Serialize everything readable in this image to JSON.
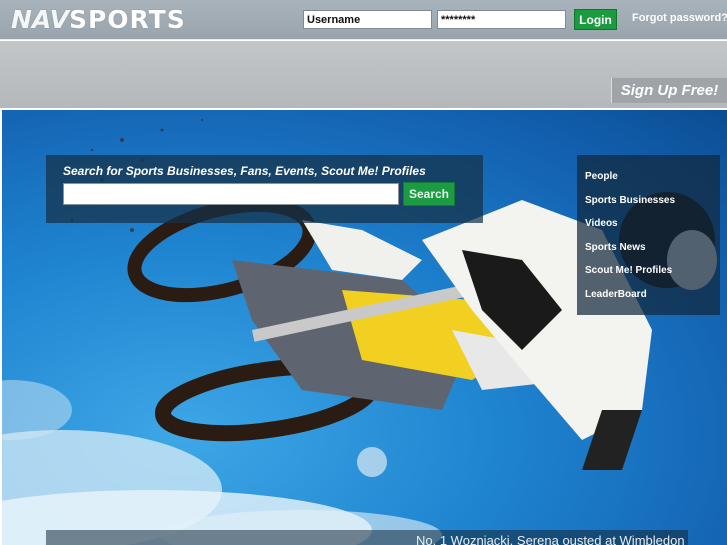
{
  "header": {
    "logo_nav": "NAV",
    "logo_sports": "SPORTS",
    "username_value": "Username",
    "password_value": "********",
    "login_label": "Login",
    "forgot_label": "Forgot password?"
  },
  "banner": {
    "signup_label": "Sign Up Free!"
  },
  "search": {
    "title": "Search for Sports Businesses, Fans, Events, Scout Me! Profiles",
    "placeholder": "",
    "button_label": "Search"
  },
  "side_nav": {
    "items": [
      {
        "label": "People"
      },
      {
        "label": "Sports Businesses"
      },
      {
        "label": "Videos"
      },
      {
        "label": "Sports News"
      },
      {
        "label": "Scout Me! Profiles"
      },
      {
        "label": "LeaderBoard"
      }
    ]
  },
  "ticker": {
    "text": "No. 1 Wozniacki, Serena ousted at Wimbledon"
  },
  "colors": {
    "header_bg": "#a9b3bb",
    "banner_bg": "#bcc0c3",
    "accent_green": "#1b9b3f",
    "sky_blue": "#1f85d1"
  }
}
